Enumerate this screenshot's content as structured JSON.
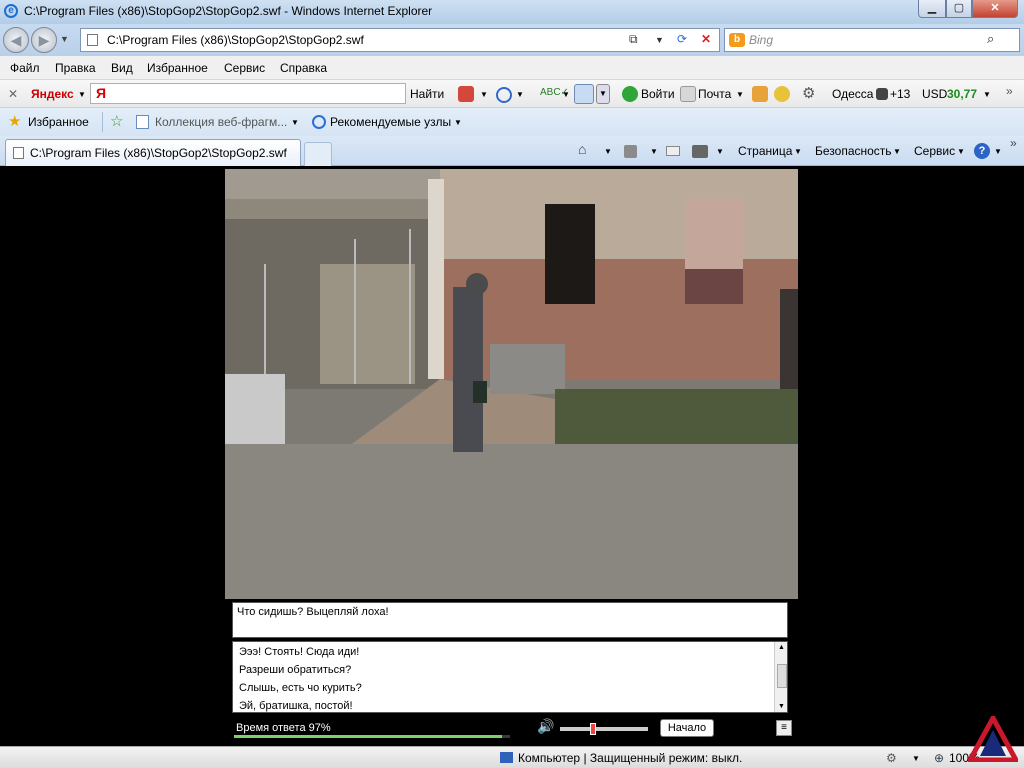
{
  "window": {
    "title": "C:\\Program Files (x86)\\StopGop2\\StopGop2.swf - Windows Internet Explorer",
    "btn_min": "▁",
    "btn_max": "▢",
    "btn_close": "✕"
  },
  "address": {
    "url": "C:\\Program Files (x86)\\StopGop2\\StopGop2.swf"
  },
  "search": {
    "placeholder": "Bing"
  },
  "menu": [
    "Файл",
    "Правка",
    "Вид",
    "Избранное",
    "Сервис",
    "Справка"
  ],
  "yandex": {
    "brand": "Яндекс",
    "find": "Найти",
    "login": "Войти",
    "mail": "Почта",
    "city": "Одесса",
    "temp": "+13",
    "currency": "USD",
    "rate": "30,77"
  },
  "favorites": {
    "label": "Избранное",
    "gallery": "Коллекция веб-фрагм...",
    "suggested": "Рекомендуемые узлы"
  },
  "tabs": {
    "active_title": "C:\\Program Files (x86)\\StopGop2\\StopGop2.swf",
    "page_menu": "Страница",
    "safety_menu": "Безопасность",
    "tools_menu": "Сервис"
  },
  "game": {
    "prompt": "Что сидишь? Выцепляй лоха!",
    "answers": [
      "Эээ! Стоять! Сюда иди!",
      "Разреши обратиться?",
      "Слышь, есть чо курить?",
      "Эй, братишка, постой!"
    ],
    "timer_label": "Время ответа 97%",
    "timer_fraction": 0.97,
    "volume_fraction": 0.37,
    "start_button": "Начало"
  },
  "status": {
    "zone": "Компьютер | Защищенный режим: выкл.",
    "zoom": "100%"
  }
}
